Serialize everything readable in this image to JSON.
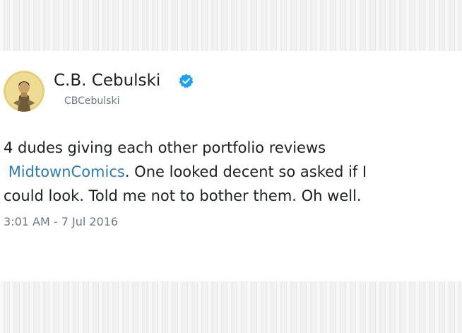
{
  "tweet": {
    "display_name": "C.B. Cebulski",
    "handle": "CBCebulski",
    "verified": true,
    "text_line1": "4 dudes giving each other portfolio reviews",
    "mention_prefix": " ",
    "mention": "MidtownComics",
    "text_line2_rest": ". One looked decent so asked if I",
    "text_line3": "could look. Told me not to bother them. Oh well.",
    "timestamp": "3:01 AM - 7 Jul 2016"
  },
  "colors": {
    "text": "#1c2022",
    "secondary": "#697882",
    "link": "#2b7bb9",
    "verified": "#1da1f2"
  },
  "icons": {
    "verified": "verified-badge-icon",
    "avatar": "profile-avatar"
  }
}
